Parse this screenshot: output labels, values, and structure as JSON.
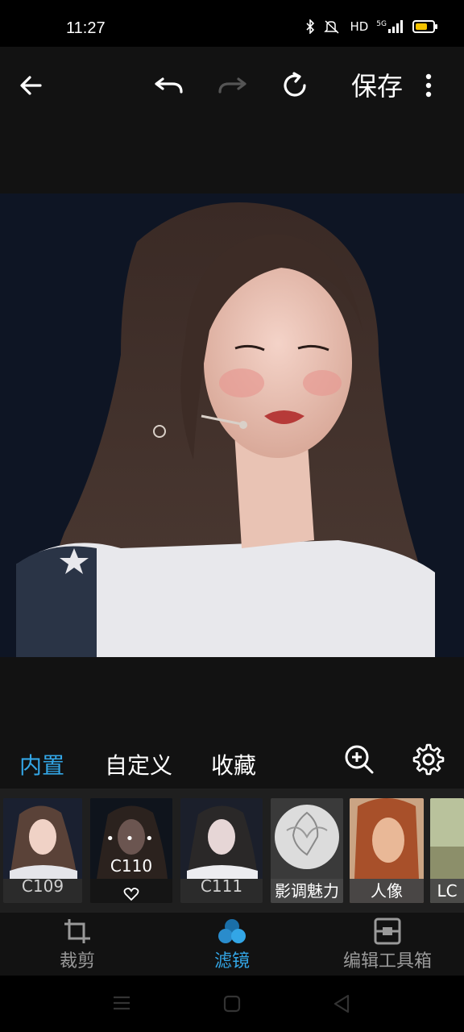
{
  "status_bar": {
    "time": "11:27",
    "icons": [
      "bluetooth-icon",
      "mute-icon",
      "hd-icon",
      "signal-5g-icon",
      "battery-icon"
    ],
    "hd_label": "HD",
    "network_label": "5G"
  },
  "toolbar": {
    "back_icon": "arrow-left-icon",
    "undo_icon": "undo-icon",
    "redo_icon": "redo-icon",
    "reset_icon": "reset-icon",
    "save_label": "保存",
    "more_icon": "more-vertical-icon"
  },
  "photo": {
    "description_icon": "photo-canvas"
  },
  "tabs": {
    "builtin": "内置",
    "custom": "自定义",
    "favorites": "收藏",
    "zoom_icon": "zoom-in-icon",
    "settings_icon": "gear-icon",
    "active_color": "#33a6e6"
  },
  "filters": [
    {
      "label": "C109",
      "selected": false
    },
    {
      "label": "C110",
      "selected": true,
      "dots": "• • •"
    },
    {
      "label": "C111",
      "selected": false
    },
    {
      "label": "影调魅力",
      "selected": false
    },
    {
      "label": "人像",
      "selected": false
    },
    {
      "label": "LC",
      "selected": false
    }
  ],
  "bottom_nav": {
    "crop": "裁剪",
    "filter": "滤镜",
    "toolbox": "编辑工具箱"
  },
  "android_nav": {
    "menu_icon": "menu-icon",
    "home_icon": "home-square-icon",
    "back_icon": "back-triangle-icon"
  }
}
